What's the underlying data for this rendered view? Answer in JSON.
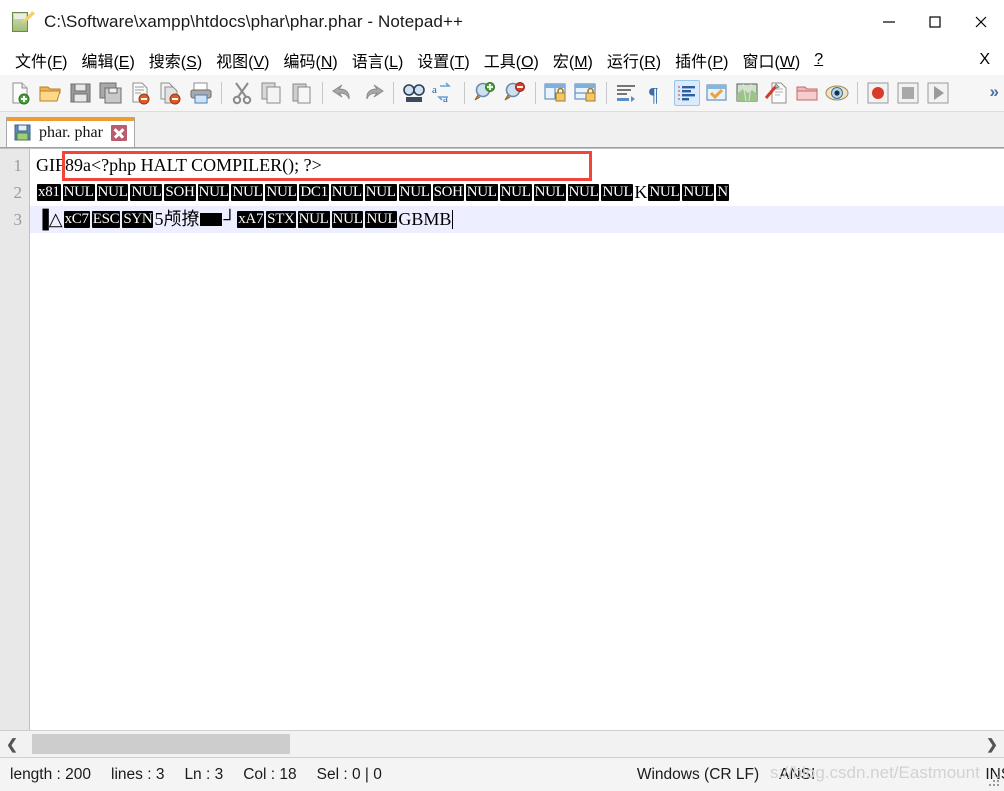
{
  "window": {
    "title": "C:\\Software\\xampp\\htdocs\\phar\\phar.phar - Notepad++",
    "app_icon": "notepad-plus-plus-icon",
    "minimize_label": "—",
    "maximize_label": "□",
    "close_label": "✕"
  },
  "menu": {
    "items": [
      {
        "label": "文件(F)",
        "text": "文件(",
        "acc": "F",
        "tail": ")"
      },
      {
        "label": "编辑(E)",
        "text": "编辑(",
        "acc": "E",
        "tail": ")"
      },
      {
        "label": "搜索(S)",
        "text": "搜索(",
        "acc": "S",
        "tail": ")"
      },
      {
        "label": "视图(V)",
        "text": "视图(",
        "acc": "V",
        "tail": ")"
      },
      {
        "label": "编码(N)",
        "text": "编码(",
        "acc": "N",
        "tail": ")"
      },
      {
        "label": "语言(L)",
        "text": "语言(",
        "acc": "L",
        "tail": ")"
      },
      {
        "label": "设置(T)",
        "text": "设置(",
        "acc": "T",
        "tail": ")"
      },
      {
        "label": "工具(O)",
        "text": "工具(",
        "acc": "O",
        "tail": ")"
      },
      {
        "label": "宏(M)",
        "text": "宏(",
        "acc": "M",
        "tail": ")"
      },
      {
        "label": "运行(R)",
        "text": "运行(",
        "acc": "R",
        "tail": ")"
      },
      {
        "label": "插件(P)",
        "text": "插件(",
        "acc": "P",
        "tail": ")"
      },
      {
        "label": "窗口(W)",
        "text": "窗口(",
        "acc": "W",
        "tail": ")"
      },
      {
        "label": "?",
        "text": "",
        "acc": "?",
        "tail": ""
      }
    ],
    "close_document_label": "X"
  },
  "toolbar": {
    "overflow_label": "»",
    "buttons": [
      {
        "name": "new-file-icon"
      },
      {
        "name": "open-file-icon"
      },
      {
        "name": "save-icon"
      },
      {
        "name": "save-all-icon"
      },
      {
        "name": "close-file-icon"
      },
      {
        "name": "close-all-files-icon"
      },
      {
        "name": "print-icon"
      },
      {
        "name": "separator"
      },
      {
        "name": "cut-icon"
      },
      {
        "name": "copy-icon"
      },
      {
        "name": "paste-icon"
      },
      {
        "name": "separator"
      },
      {
        "name": "undo-icon"
      },
      {
        "name": "redo-icon"
      },
      {
        "name": "separator"
      },
      {
        "name": "find-icon"
      },
      {
        "name": "replace-icon"
      },
      {
        "name": "separator"
      },
      {
        "name": "zoom-in-icon"
      },
      {
        "name": "zoom-out-icon"
      },
      {
        "name": "separator"
      },
      {
        "name": "sync-vertical-scroll-icon"
      },
      {
        "name": "sync-horizontal-scroll-icon"
      },
      {
        "name": "separator"
      },
      {
        "name": "word-wrap-icon"
      },
      {
        "name": "show-all-characters-icon"
      },
      {
        "name": "show-indent-guide-icon"
      },
      {
        "name": "user-defined-dialog-icon"
      },
      {
        "name": "document-map-icon"
      },
      {
        "name": "function-list-icon"
      },
      {
        "name": "folder-as-workspace-icon"
      },
      {
        "name": "monitoring-icon"
      },
      {
        "name": "separator"
      },
      {
        "name": "record-macro-icon"
      },
      {
        "name": "stop-macro-icon"
      },
      {
        "name": "play-macro-icon"
      }
    ]
  },
  "tabs": [
    {
      "label": "phar. phar",
      "modified_icon": "save-icon",
      "close_icon": "close-icon",
      "active": true
    }
  ],
  "editor": {
    "line_numbers": [
      "1",
      "2",
      "3"
    ],
    "highlight_box": "red-rectangle-around-line-1",
    "lines": [
      {
        "number": "1",
        "selected": false,
        "segments": [
          {
            "type": "plain",
            "text": "GIF89a<?php   HALT COMPILER(); ?>"
          }
        ]
      },
      {
        "number": "2",
        "selected": false,
        "segments": [
          {
            "type": "token",
            "text": "x81"
          },
          {
            "type": "token",
            "text": "NUL"
          },
          {
            "type": "token",
            "text": "NUL"
          },
          {
            "type": "token",
            "text": "NUL"
          },
          {
            "type": "token",
            "text": "SOH"
          },
          {
            "type": "token",
            "text": "NUL"
          },
          {
            "type": "token",
            "text": "NUL"
          },
          {
            "type": "token",
            "text": "NUL"
          },
          {
            "type": "token",
            "text": "DC1"
          },
          {
            "type": "token",
            "text": "NUL"
          },
          {
            "type": "token",
            "text": "NUL"
          },
          {
            "type": "token",
            "text": "NUL"
          },
          {
            "type": "token",
            "text": "SOH"
          },
          {
            "type": "token",
            "text": "NUL"
          },
          {
            "type": "token",
            "text": "NUL"
          },
          {
            "type": "token",
            "text": "NUL"
          },
          {
            "type": "token",
            "text": "NUL"
          },
          {
            "type": "token",
            "text": "NUL"
          },
          {
            "type": "plain",
            "text": "K"
          },
          {
            "type": "token",
            "text": "NUL"
          },
          {
            "type": "token",
            "text": "NUL"
          },
          {
            "type": "token",
            "text": "N"
          }
        ]
      },
      {
        "number": "3",
        "selected": true,
        "segments": [
          {
            "type": "plain",
            "text": "▐△"
          },
          {
            "type": "token",
            "text": "xC7"
          },
          {
            "type": "token",
            "text": "ESC"
          },
          {
            "type": "token",
            "text": "SYN"
          },
          {
            "type": "plain",
            "text": "5颅撩"
          },
          {
            "type": "block",
            "text": ""
          },
          {
            "type": "plain",
            "text": "┘"
          },
          {
            "type": "token",
            "text": "xA7"
          },
          {
            "type": "token",
            "text": "STX"
          },
          {
            "type": "token",
            "text": "NUL"
          },
          {
            "type": "token",
            "text": "NUL"
          },
          {
            "type": "token",
            "text": "NUL"
          },
          {
            "type": "plain",
            "text": "GBMB"
          },
          {
            "type": "caret",
            "text": ""
          }
        ]
      }
    ]
  },
  "hscrollbar": {
    "left_arrow": "❮",
    "right_arrow": "❯"
  },
  "statusbar": {
    "length": "length : 200",
    "lines": "lines : 3",
    "ln": "Ln : 3",
    "col": "Col : 18",
    "sel": "Sel : 0 | 0",
    "eol": "Windows (CR LF)",
    "encoding": "ANSI",
    "insert_mode": "INS"
  },
  "watermark": "s://blog.csdn.net/Eastmount",
  "colors": {
    "accent_orange": "#ef9b2f",
    "highlight_red": "#f1443a",
    "selection_blue": "#edeeff",
    "tab_close_red": "#b85c6e",
    "gutter_bg": "#e8e8e8"
  }
}
